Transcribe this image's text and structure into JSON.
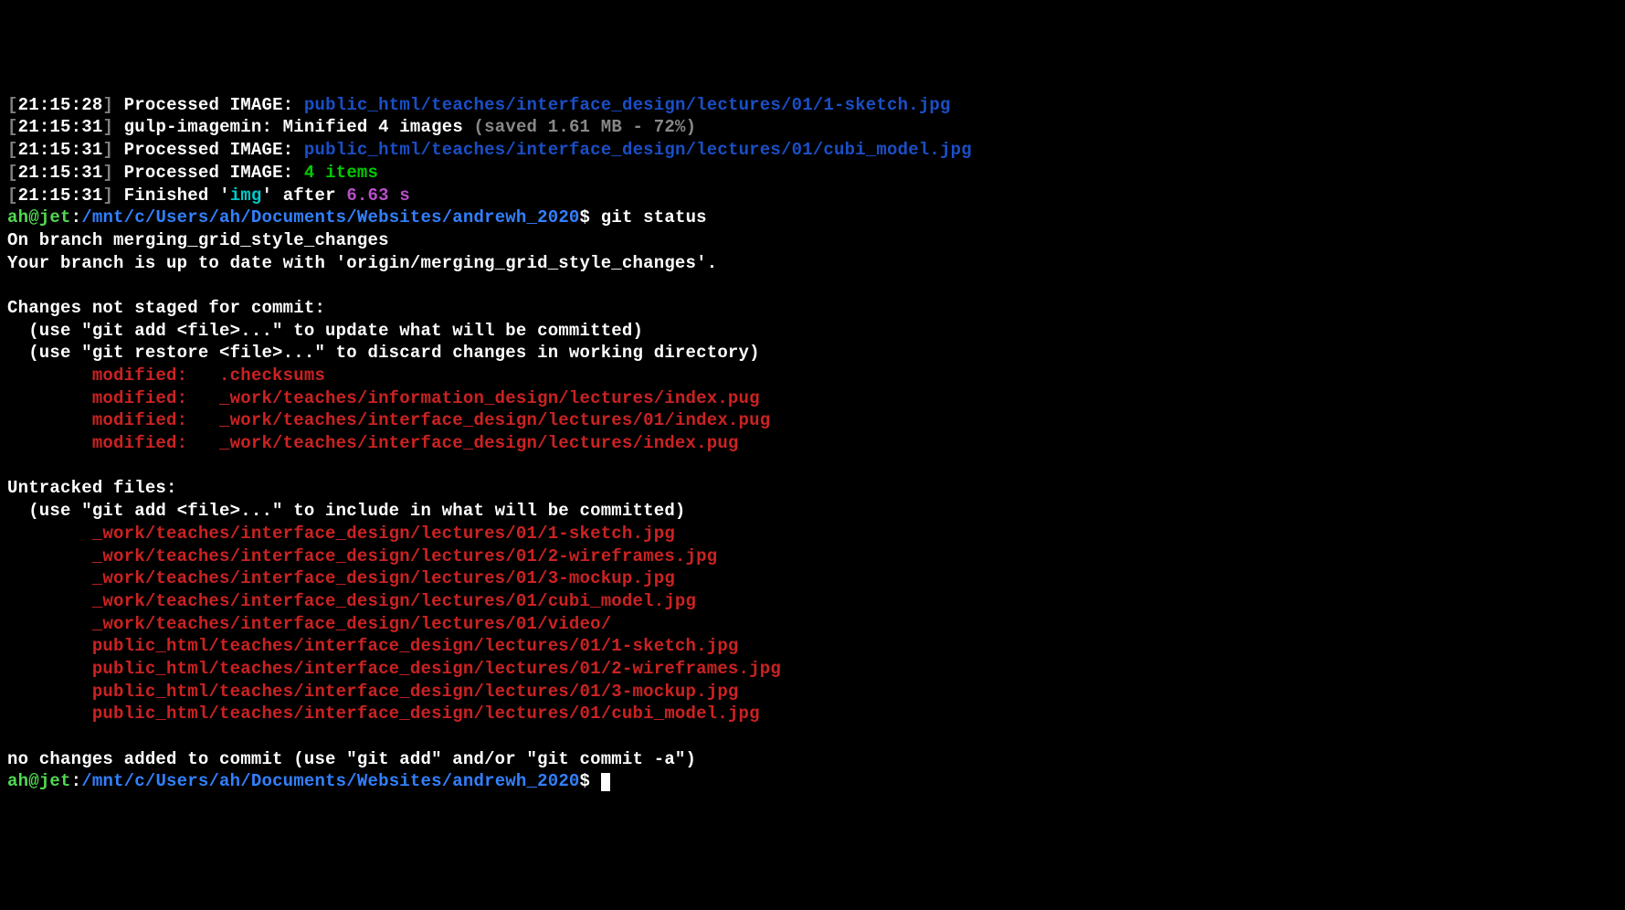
{
  "log": {
    "l1": {
      "ts": "21:15:28",
      "label": "Processed IMAGE:",
      "path": "public_html/teaches/interface_design/lectures/01/1-sketch.jpg"
    },
    "l2": {
      "ts": "21:15:31",
      "label": "gulp-imagemin: Minified 4 images",
      "extra": "(saved 1.61 MB - 72%)"
    },
    "l3": {
      "ts": "21:15:31",
      "label": "Processed IMAGE:",
      "path": "public_html/teaches/interface_design/lectures/01/cubi_model.jpg"
    },
    "l4": {
      "ts": "21:15:31",
      "label": "Processed IMAGE:",
      "count": "4 items"
    },
    "l5": {
      "ts": "21:15:31",
      "pre": "Finished '",
      "task": "img",
      "post": "' after ",
      "dur": "6.63 s"
    }
  },
  "prompt": {
    "user": "ah@jet",
    "colon": ":",
    "path": "/mnt/c/Users/ah/Documents/Websites/andrewh_2020",
    "dollar": "$",
    "cmd": "git status"
  },
  "git": {
    "branch_line": "On branch merging_grid_style_changes",
    "uptodate": "Your branch is up to date with 'origin/merging_grid_style_changes'.",
    "not_staged_header": "Changes not staged for commit:",
    "hint_add": "  (use \"git add <file>...\" to update what will be committed)",
    "hint_restore": "  (use \"git restore <file>...\" to discard changes in working directory)",
    "modified": {
      "m1": "        modified:   .checksums",
      "m2": "        modified:   _work/teaches/information_design/lectures/index.pug",
      "m3": "        modified:   _work/teaches/interface_design/lectures/01/index.pug",
      "m4": "        modified:   _work/teaches/interface_design/lectures/index.pug"
    },
    "untracked_header": "Untracked files:",
    "hint_include": "  (use \"git add <file>...\" to include in what will be committed)",
    "untracked": {
      "u1": "        _work/teaches/interface_design/lectures/01/1-sketch.jpg",
      "u2": "        _work/teaches/interface_design/lectures/01/2-wireframes.jpg",
      "u3": "        _work/teaches/interface_design/lectures/01/3-mockup.jpg",
      "u4": "        _work/teaches/interface_design/lectures/01/cubi_model.jpg",
      "u5": "        _work/teaches/interface_design/lectures/01/video/",
      "u6": "        public_html/teaches/interface_design/lectures/01/1-sketch.jpg",
      "u7": "        public_html/teaches/interface_design/lectures/01/2-wireframes.jpg",
      "u8": "        public_html/teaches/interface_design/lectures/01/3-mockup.jpg",
      "u9": "        public_html/teaches/interface_design/lectures/01/cubi_model.jpg"
    },
    "footer": "no changes added to commit (use \"git add\" and/or \"git commit -a\")"
  }
}
